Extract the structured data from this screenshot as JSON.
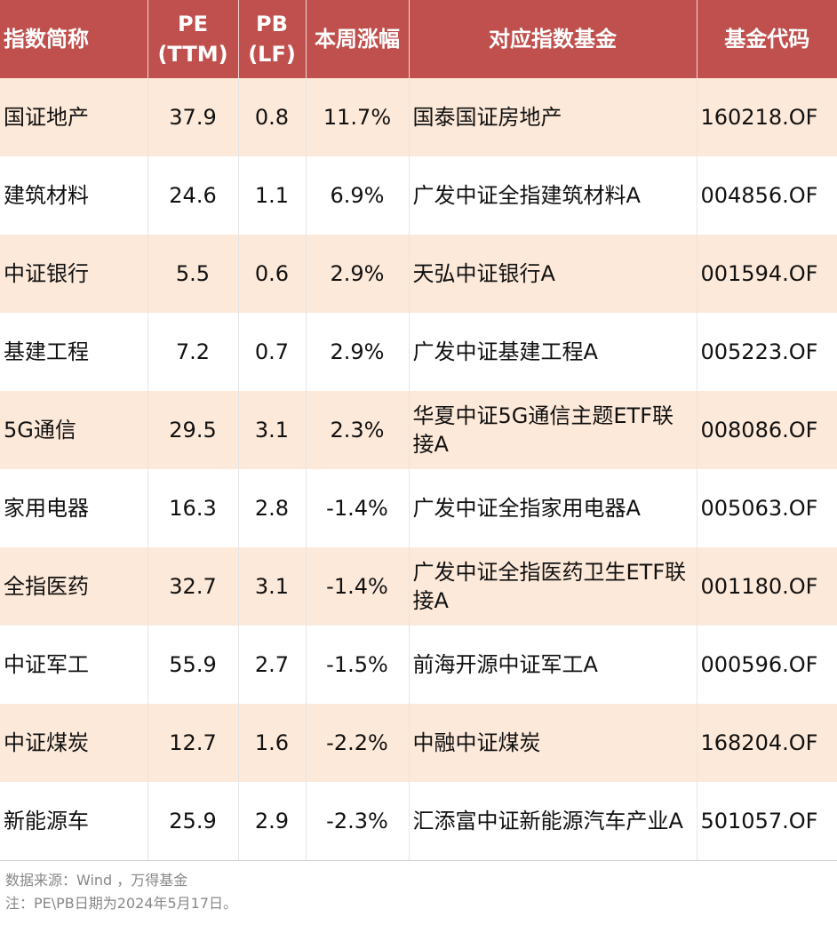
{
  "table": {
    "headers": [
      "指数简称",
      "PE\n(TTM)",
      "PB\n(LF)",
      "本周涨幅",
      "对应指数基金",
      "基金代码"
    ],
    "rows": [
      {
        "name": "国证地产",
        "pe": "37.9",
        "pb": "0.8",
        "change": "11.7%",
        "trend": "up",
        "fund": "国泰国证房地产",
        "code": "160218.OF"
      },
      {
        "name": "建筑材料",
        "pe": "24.6",
        "pb": "1.1",
        "change": "6.9%",
        "trend": "up",
        "fund": "广发中证全指建筑材料A",
        "code": "004856.OF"
      },
      {
        "name": "中证银行",
        "pe": "5.5",
        "pb": "0.6",
        "change": "2.9%",
        "trend": "up",
        "fund": "天弘中证银行A",
        "code": "001594.OF"
      },
      {
        "name": "基建工程",
        "pe": "7.2",
        "pb": "0.7",
        "change": "2.9%",
        "trend": "up",
        "fund": "广发中证基建工程A",
        "code": "005223.OF"
      },
      {
        "name": "5G通信",
        "pe": "29.5",
        "pb": "3.1",
        "change": "2.3%",
        "trend": "up",
        "fund": "华夏中证5G通信主题ETF联接A",
        "code": "008086.OF"
      },
      {
        "name": "家用电器",
        "pe": "16.3",
        "pb": "2.8",
        "change": "-1.4%",
        "trend": "down",
        "fund": "广发中证全指家用电器A",
        "code": "005063.OF"
      },
      {
        "name": "全指医药",
        "pe": "32.7",
        "pb": "3.1",
        "change": "-1.4%",
        "trend": "down",
        "fund": "广发中证全指医药卫生ETF联接A",
        "code": "001180.OF"
      },
      {
        "name": "中证军工",
        "pe": "55.9",
        "pb": "2.7",
        "change": "-1.5%",
        "trend": "down",
        "fund": "前海开源中证军工A",
        "code": "000596.OF"
      },
      {
        "name": "中证煤炭",
        "pe": "12.7",
        "pb": "1.6",
        "change": "-2.2%",
        "trend": "down",
        "fund": "中融中证煤炭",
        "code": "168204.OF"
      },
      {
        "name": "新能源车",
        "pe": "25.9",
        "pb": "2.9",
        "change": "-2.3%",
        "trend": "down",
        "fund": "汇添富中证新能源汽车产业A",
        "code": "501057.OF"
      }
    ]
  },
  "watermark": "Wind",
  "footer": {
    "source": "数据来源：Wind ，万得基金",
    "note": "注：PE\\PB日期为2024年5月17日。"
  },
  "colors": {
    "header_bg": "#c0504d",
    "row_alt_bg": "#fde9d9",
    "positive": "#e8231b",
    "negative": "#1aa64a"
  }
}
